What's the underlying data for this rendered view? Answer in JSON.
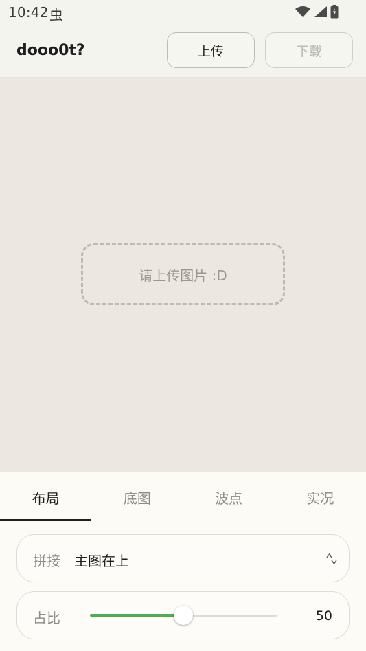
{
  "status_bar": {
    "time": "10:42",
    "notification_glyph": "虫",
    "icons": [
      "wifi-icon",
      "signal-icon",
      "battery-icon"
    ]
  },
  "header": {
    "title": "dooo0t?",
    "upload_label": "上传",
    "download_label": "下载"
  },
  "canvas": {
    "placeholder": "请上传图片 :D"
  },
  "tabs": [
    {
      "label": "布局",
      "active": true
    },
    {
      "label": "底图",
      "active": false
    },
    {
      "label": "波点",
      "active": false
    },
    {
      "label": "实况",
      "active": false
    }
  ],
  "layout": {
    "join_label": "拼接",
    "join_value": "主图在上",
    "ratio_label": "占比",
    "ratio_value": 50,
    "ratio_max": 100
  },
  "colors": {
    "accent": "#4caf50"
  }
}
